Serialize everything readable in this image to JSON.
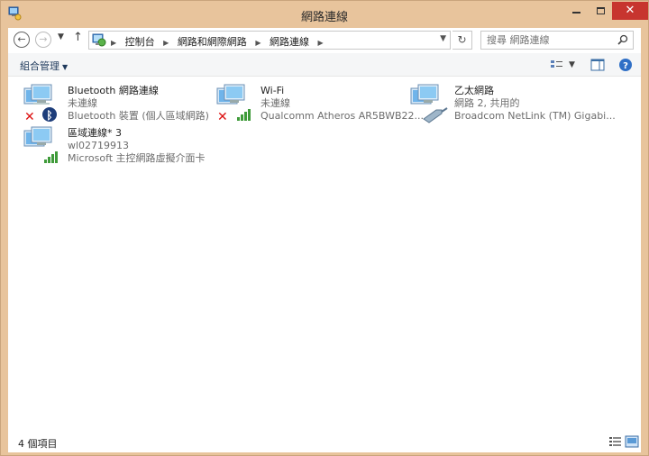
{
  "window": {
    "title": "網路連線",
    "colors": {
      "frame": "#e8c49c",
      "close": "#c7352f",
      "link": "#1e395b"
    }
  },
  "address_bar": {
    "breadcrumbs": [
      "控制台",
      "網路和網際網路",
      "網路連線"
    ],
    "search_placeholder": "搜尋 網路連線"
  },
  "command_bar": {
    "organize_label": "組合管理"
  },
  "connections": [
    {
      "name": "Bluetooth 網路連線",
      "status": "未連線",
      "device": "Bluetooth 裝置 (個人區域網路)",
      "badge": "bluetooth-icon",
      "disabled": true
    },
    {
      "name": "Wi-Fi",
      "status": "未連線",
      "device": "Qualcomm Atheros AR5BWB22...",
      "badge": "signal-bars-icon",
      "disabled": true
    },
    {
      "name": "乙太網路",
      "status": "網路  2, 共用的",
      "device": "Broadcom NetLink (TM) Gigabi...",
      "badge": "ethernet-cable-icon",
      "disabled": false
    },
    {
      "name": "區域連線* 3",
      "status": "wl02719913",
      "device": "Microsoft 主控網路虛擬介面卡",
      "badge": "signal-bars-icon",
      "disabled": false
    }
  ],
  "status_bar": {
    "item_count": "4 個項目"
  }
}
